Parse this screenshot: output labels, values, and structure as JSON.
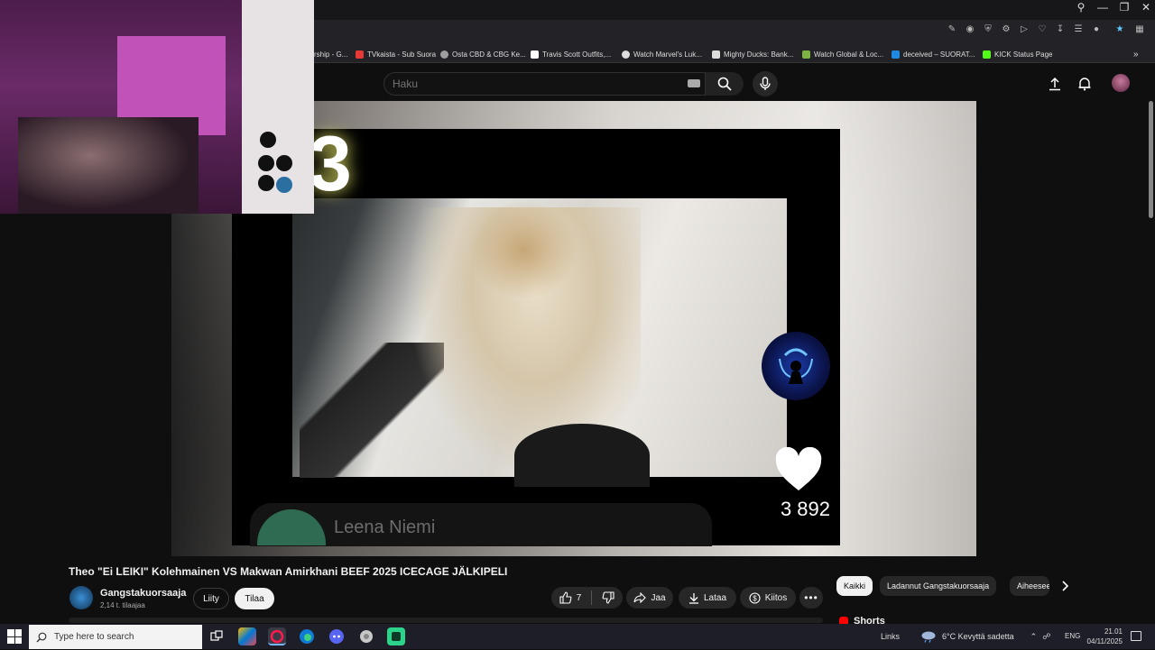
{
  "browser": {
    "bookmarks": [
      {
        "label": "rship - G...",
        "color": "#4285f4"
      },
      {
        "label": "TVkaista - Sub Suora",
        "color": "#e53935"
      },
      {
        "label": "Osta CBD & CBG Ke...",
        "color": "#9e9e9e"
      },
      {
        "label": "Travis Scott Outfits,...",
        "color": "#ffffff"
      },
      {
        "label": "Watch Marvel's Luk...",
        "color": "#dddddd"
      },
      {
        "label": "Mighty Ducks: Bank...",
        "color": "#dddddd"
      },
      {
        "label": "Watch Global & Loc...",
        "color": "#7cb342"
      },
      {
        "label": "deceived – SUORAT...",
        "color": "#1e88e5"
      },
      {
        "label": "KICK Status Page",
        "color": "#53fc18"
      }
    ]
  },
  "header": {
    "search_placeholder": "Haku"
  },
  "player": {
    "overlay_number": "3",
    "like_count": "3 892",
    "comment_author": "Leena Niemi"
  },
  "video": {
    "title": "Theo \"Ei LEIKI\" Kolehmainen VS Makwan Amirkhani BEEF 2025 ICECAGE JÄLKIPELI",
    "channel_name": "Gangstakuorsaaja",
    "subscribers": "2,14 t. tilaajaa",
    "join_label": "Liity",
    "subscribe_label": "Tilaa",
    "likes": "7",
    "share_label": "Jaa",
    "download_label": "Lataa",
    "thanks_label": "Kiitos"
  },
  "sidebar": {
    "chips": [
      "Kaikki",
      "Ladannut Gangstakuorsaaja",
      "Aiheeseen"
    ],
    "shorts_label": "Shorts"
  },
  "taskbar": {
    "search_placeholder": "Type here to search",
    "links_label": "Links",
    "weather": "6°C  Kevyttä sadetta",
    "language": "ENG",
    "time": "21.01",
    "date": "04/11/2025"
  },
  "colors": {
    "accent_red": "#ff0000",
    "background": "#0f0f0f",
    "chip_active": "#f1f1f1"
  }
}
